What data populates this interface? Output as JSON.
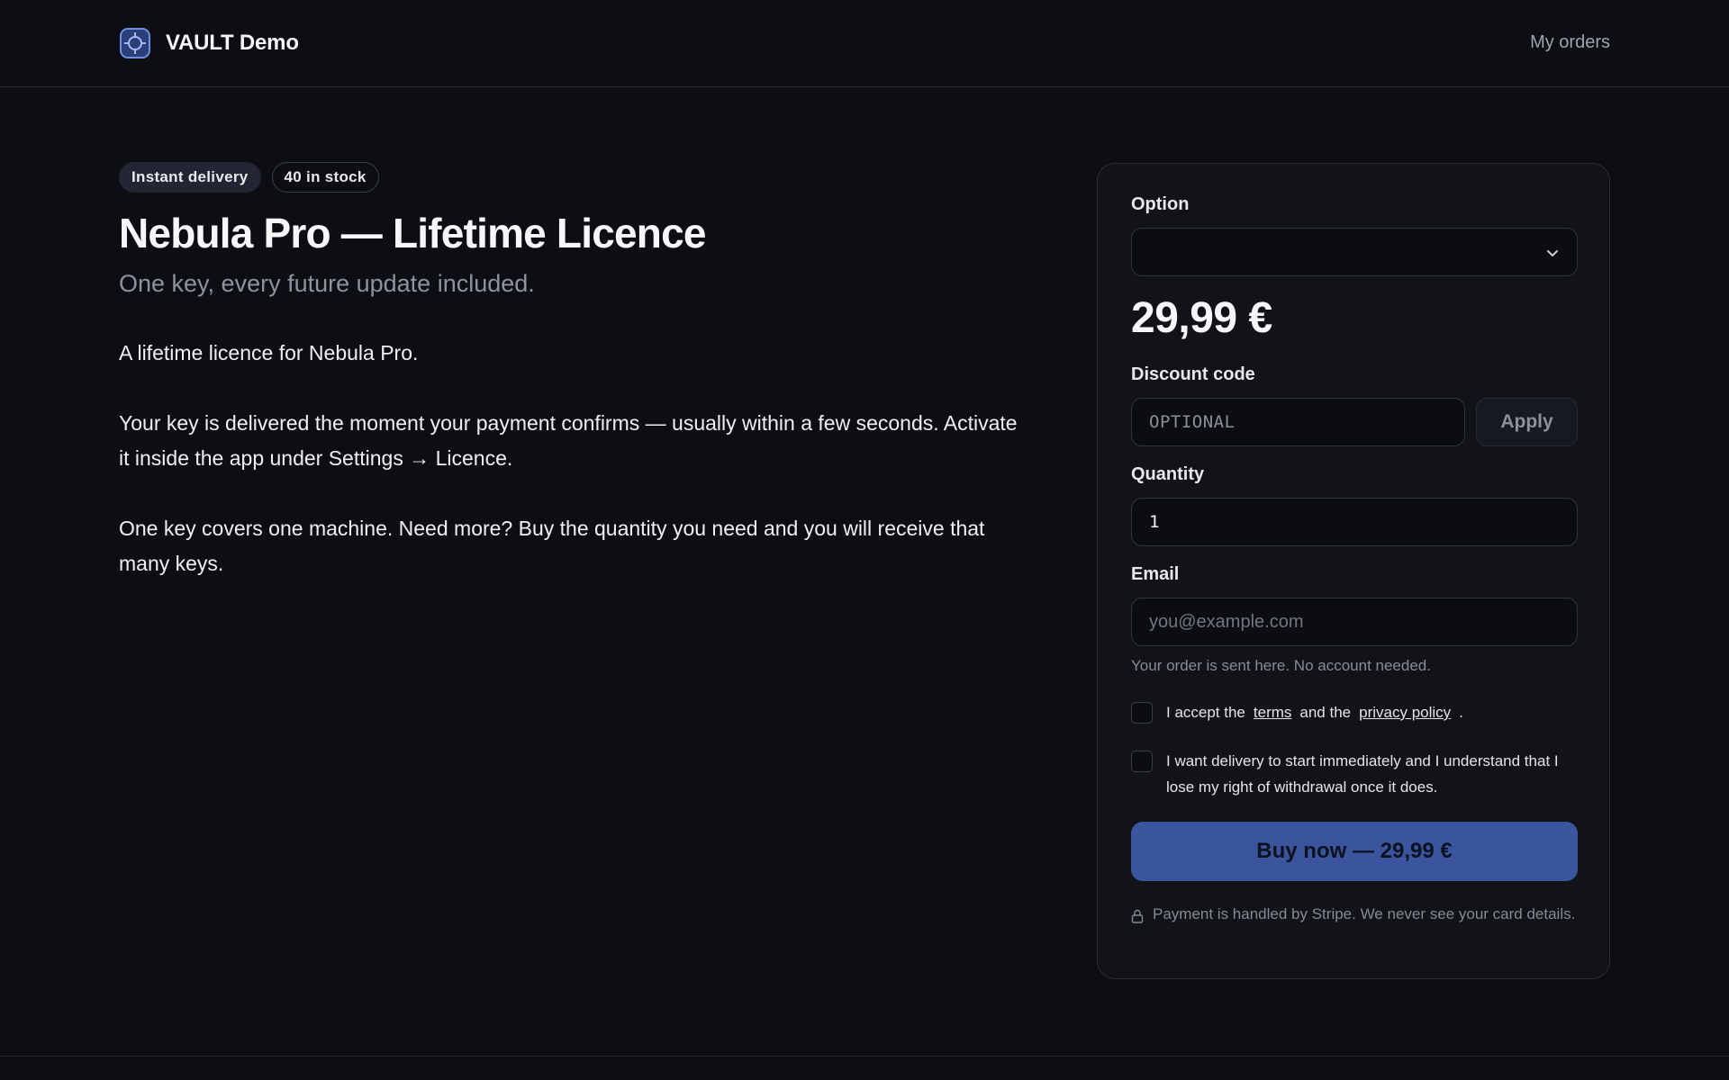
{
  "app": {
    "brand_name": "VAULT Demo",
    "logo_icon": "crosshair-logo-icon",
    "accent_color": "#3a559e"
  },
  "nav": {
    "my_orders": "My orders"
  },
  "product": {
    "badges": [
      "Instant delivery",
      "40 in stock"
    ],
    "title": "Nebula Pro — Lifetime Licence",
    "subtitle": "One key, every future update included.",
    "description": [
      "A lifetime licence for Nebula Pro.",
      "Your key is delivered the moment your payment confirms — usually within a few seconds. Activate it inside the app under Settings → Licence.",
      "One key covers one machine. Need more? Buy the quantity you need and you will receive that many keys."
    ]
  },
  "checkout": {
    "option_label": "Option",
    "option_value": "",
    "price": "29,99 €",
    "discount_label": "Discount code",
    "discount_placeholder": "OPTIONAL",
    "apply_label": "Apply",
    "quantity_label": "Quantity",
    "quantity_value": "1",
    "email_label": "Email",
    "email_placeholder": "you@example.com",
    "email_hint": "Your order is sent here. No account needed.",
    "terms": {
      "prefix": "I accept the",
      "terms_link": "terms",
      "middle": "and the",
      "privacy_link": "privacy policy",
      "suffix": "."
    },
    "withdrawal_text": "I want delivery to start immediately and I understand that I lose my right of withdrawal once it does.",
    "buy_label": "Buy now — 29,99 €",
    "secure_note": "Payment is handled by Stripe. We never see your card details."
  }
}
